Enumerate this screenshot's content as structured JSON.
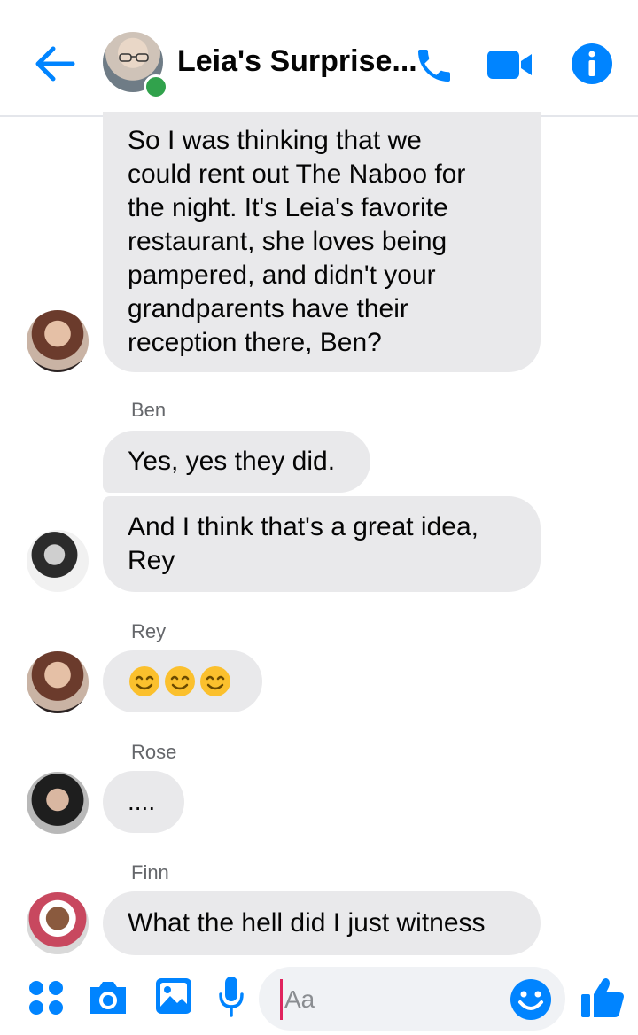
{
  "header": {
    "title": "Leia's Surprise..."
  },
  "messages": [
    {
      "text": "So I was thinking that we could rent out The Naboo for the night. It's Leia's favorite restaurant, she loves being pampered, and didn't your grandparents have their reception there, Ben?",
      "lines": [
        "So I was thinking that we",
        "could rent out The Naboo for",
        "the night. It's Leia's favorite",
        "restaurant, she loves being",
        "pampered, and didn't your",
        "grandparents have their",
        "reception there, Ben?"
      ]
    },
    {
      "sender": "Ben",
      "text": "Yes, yes they did."
    },
    {
      "text": "And I think that's a great idea, Rey",
      "lines": [
        "And I think that's a great idea,",
        "Rey"
      ]
    },
    {
      "sender": "Rey",
      "emoji": "😊😊😊"
    },
    {
      "sender": "Rose",
      "text": "...."
    },
    {
      "sender": "Finn",
      "text": "What the hell did I just witness"
    }
  ],
  "composer": {
    "placeholder": "Aa"
  },
  "colors": {
    "accent": "#0084ff",
    "bubble": "#e9e9eb",
    "online": "#31a24c"
  },
  "icons": [
    "back-arrow-icon",
    "phone-icon",
    "video-camera-icon",
    "info-icon",
    "apps-icon",
    "camera-icon",
    "gallery-icon",
    "microphone-icon",
    "smiley-icon",
    "thumbs-up-icon"
  ]
}
